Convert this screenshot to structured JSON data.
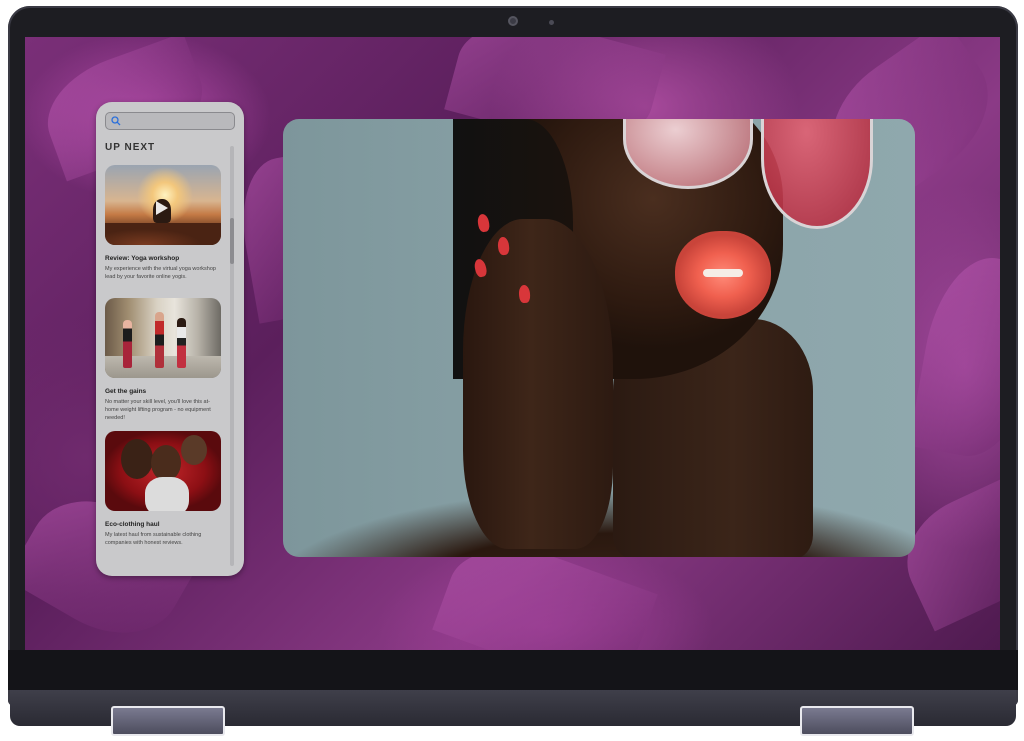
{
  "panel": {
    "search_placeholder": "",
    "heading": "UP NEXT",
    "items": [
      {
        "title": "Review: Yoga workshop",
        "description": "My experience with the virtual yoga workshop lead by your favorite online yogis.",
        "thumbnail": "yoga-sunset"
      },
      {
        "title": "Get the gains",
        "description": "No matter your skill level, you'll love this at-home weight lifting program - no equipment needed!",
        "thumbnail": "street-roller-skaters"
      },
      {
        "title": "Eco-clothing haul",
        "description": "My latest haul from sustainable clothing companies with honest reviews.",
        "thumbnail": "two-women-red-background"
      }
    ]
  },
  "video": {
    "subject": "portrait-woman-sunglasses"
  },
  "colors": {
    "wallpaper": "#7a2f78",
    "panel_bg": "#c9c9cb",
    "lips": "#f0604f",
    "nails": "#d8363a"
  }
}
